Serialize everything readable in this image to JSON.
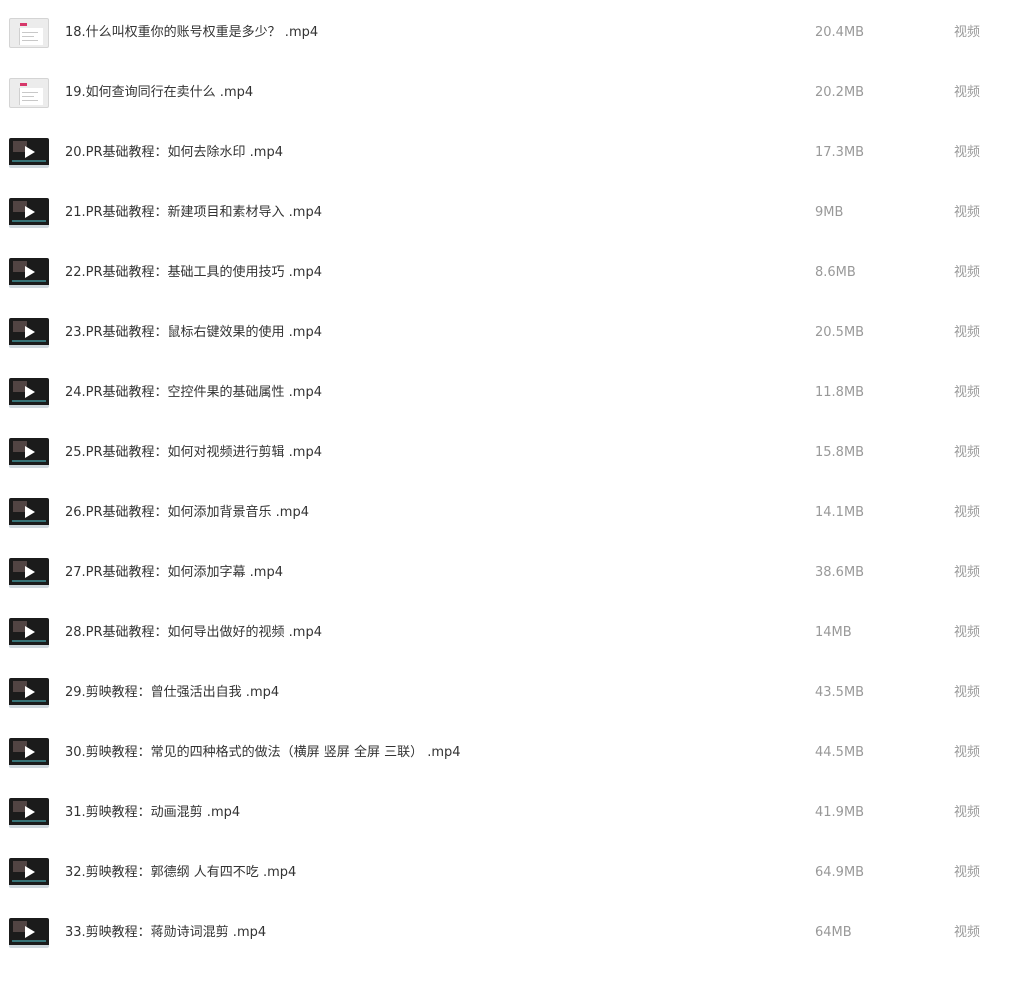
{
  "files": [
    {
      "name": "18.什么叫权重你的账号权重是多少？ .mp4",
      "size": "20.4MB",
      "type": "视频",
      "thumb": "doc-thumbnail"
    },
    {
      "name": "19.如何查询同行在卖什么 .mp4",
      "size": "20.2MB",
      "type": "视频",
      "thumb": "doc-thumbnail"
    },
    {
      "name": "20.PR基础教程：如何去除水印 .mp4",
      "size": "17.3MB",
      "type": "视频",
      "thumb": "video-thumbnail"
    },
    {
      "name": "21.PR基础教程：新建项目和素材导入 .mp4",
      "size": "9MB",
      "type": "视频",
      "thumb": "video-thumbnail"
    },
    {
      "name": "22.PR基础教程：基础工具的使用技巧 .mp4",
      "size": "8.6MB",
      "type": "视频",
      "thumb": "video-thumbnail"
    },
    {
      "name": "23.PR基础教程：鼠标右键效果的使用 .mp4",
      "size": "20.5MB",
      "type": "视频",
      "thumb": "video-thumbnail"
    },
    {
      "name": "24.PR基础教程：空控件果的基础属性 .mp4",
      "size": "11.8MB",
      "type": "视频",
      "thumb": "video-thumbnail"
    },
    {
      "name": "25.PR基础教程：如何对视频进行剪辑 .mp4",
      "size": "15.8MB",
      "type": "视频",
      "thumb": "video-thumbnail"
    },
    {
      "name": "26.PR基础教程：如何添加背景音乐 .mp4",
      "size": "14.1MB",
      "type": "视频",
      "thumb": "video-thumbnail"
    },
    {
      "name": "27.PR基础教程：如何添加字幕 .mp4",
      "size": "38.6MB",
      "type": "视频",
      "thumb": "video-thumbnail"
    },
    {
      "name": "28.PR基础教程：如何导出做好的视频 .mp4",
      "size": "14MB",
      "type": "视频",
      "thumb": "video-thumbnail"
    },
    {
      "name": "29.剪映教程：曾仕强活出自我 .mp4",
      "size": "43.5MB",
      "type": "视频",
      "thumb": "video-thumbnail"
    },
    {
      "name": "30.剪映教程：常见的四种格式的做法（横屏 竖屏 全屏 三联） .mp4",
      "size": "44.5MB",
      "type": "视频",
      "thumb": "video-thumbnail"
    },
    {
      "name": "31.剪映教程：动画混剪 .mp4",
      "size": "41.9MB",
      "type": "视频",
      "thumb": "video-thumbnail"
    },
    {
      "name": "32.剪映教程：郭德纲 人有四不吃 .mp4",
      "size": "64.9MB",
      "type": "视频",
      "thumb": "video-thumbnail"
    },
    {
      "name": "33.剪映教程：蒋勋诗词混剪 .mp4",
      "size": "64MB",
      "type": "视频",
      "thumb": "video-thumbnail"
    }
  ]
}
